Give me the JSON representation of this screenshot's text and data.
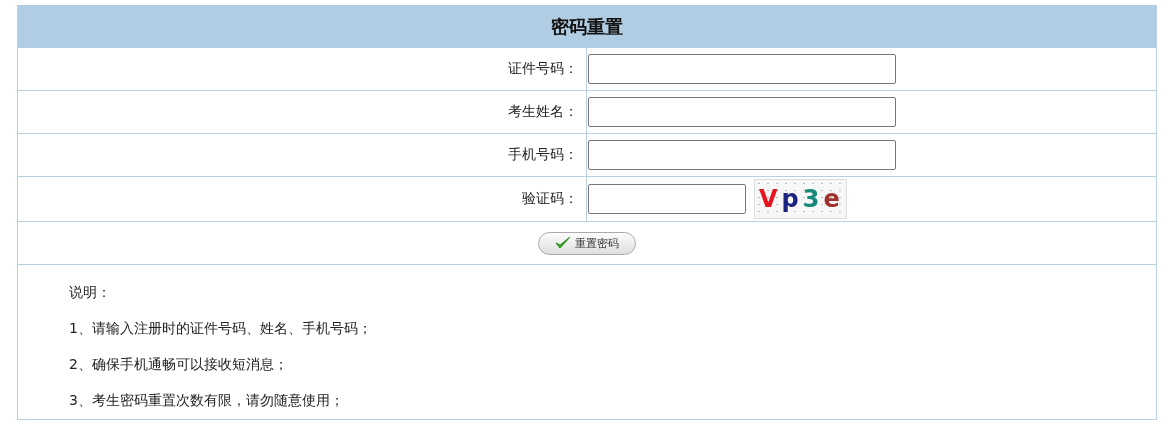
{
  "title": "密码重置",
  "fields": [
    {
      "label": "证件号码：",
      "kind": "text"
    },
    {
      "label": "考生姓名：",
      "kind": "text"
    },
    {
      "label": "手机号码：",
      "kind": "text"
    },
    {
      "label": "验证码：",
      "kind": "captcha"
    }
  ],
  "captcha": [
    {
      "text": "V",
      "color": "#e8141e"
    },
    {
      "text": "p",
      "color": "#1a237e"
    },
    {
      "text": "3",
      "color": "#16897a"
    },
    {
      "text": "e",
      "color": "#a0322e"
    }
  ],
  "button": {
    "label": "重置密码"
  },
  "notes": [
    "说明：",
    "1、请输入注册时的证件号码、姓名、手机号码；",
    "2、确保手机通畅可以接收短消息；",
    "3、考生密码重置次数有限，请勿随意使用；"
  ]
}
